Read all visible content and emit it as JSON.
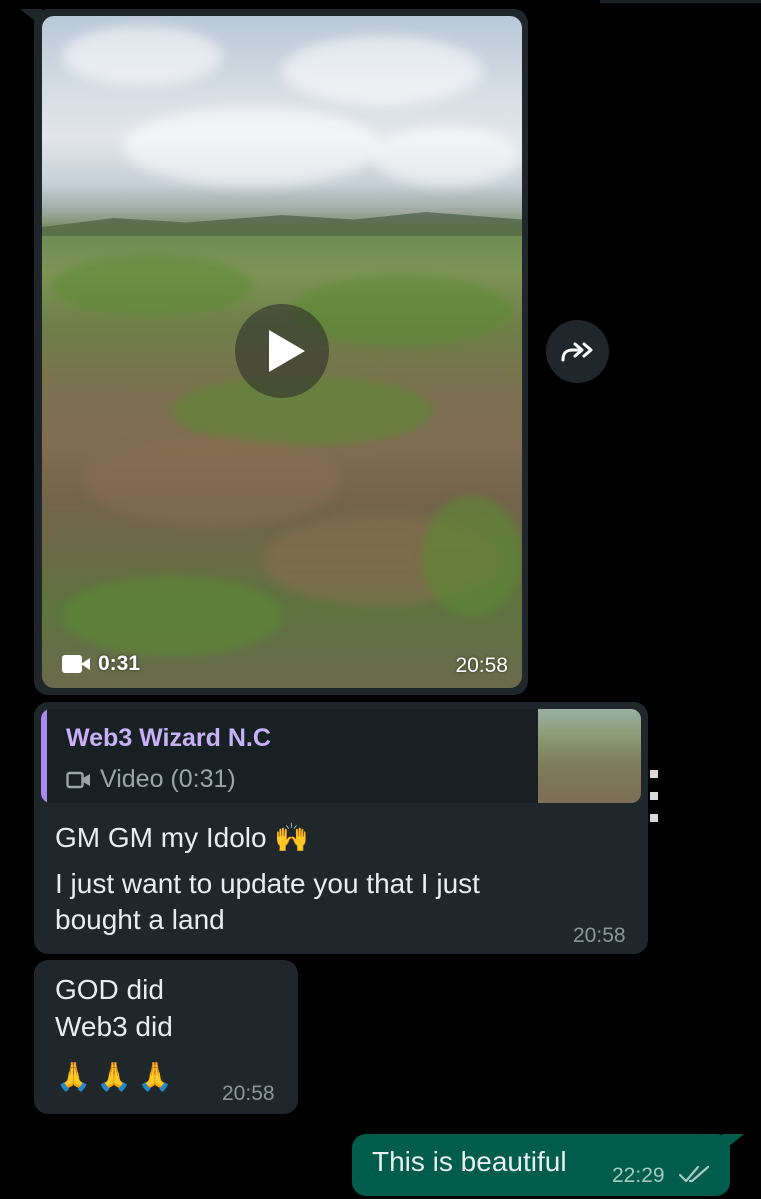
{
  "video_message": {
    "duration": "0:31",
    "time": "20:58",
    "thumbnail_icon": "play-icon"
  },
  "forward_icon": "forward-icon",
  "reply_message": {
    "quoted": {
      "author": "Web3 Wizard N.C",
      "type": "Video (0:31)",
      "type_icon": "video-camera-icon"
    },
    "line1": "GM GM my Idolo 🙌",
    "line2": "I just want to update you that I just",
    "line3": "bought a land",
    "time": "20:58"
  },
  "incoming_message_2": {
    "line1": "GOD did",
    "line2": "Web3 did",
    "emojis": "🙏🙏🙏",
    "time": "20:58"
  },
  "outgoing_message": {
    "text": "This is beautiful",
    "time": "22:29",
    "status_icon": "double-check-icon"
  },
  "colors": {
    "background": "#000000",
    "incoming_bubble": "#1f272b",
    "outgoing_bubble": "#005c4b",
    "quote_accent": "#a98bf0"
  }
}
